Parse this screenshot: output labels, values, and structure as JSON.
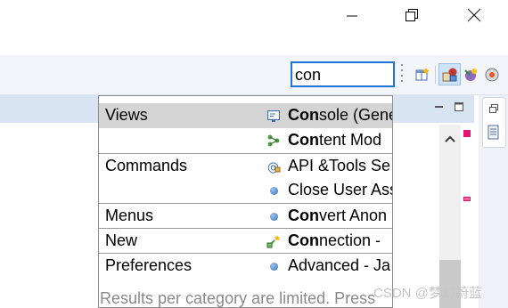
{
  "search": {
    "value": "con"
  },
  "popup": {
    "rows": [
      {
        "category": "Views",
        "match": "Con",
        "rest": "sole (Gene",
        "icon": "console-icon"
      },
      {
        "category": "",
        "match": "Con",
        "rest": "tent Mod",
        "icon": "content-model-icon"
      },
      {
        "category": "Commands",
        "match": "",
        "rest": "API &Tools Se",
        "icon": "api-tools-icon"
      },
      {
        "category": "",
        "match": "",
        "rest": "Close User Ass",
        "icon": "bullet-icon"
      },
      {
        "category": "Menus",
        "match": "Con",
        "rest": "vert Anon",
        "icon": "bullet-icon"
      },
      {
        "category": "New",
        "match": "Con",
        "rest": "nection -",
        "icon": "new-connection-icon"
      },
      {
        "category": "Preferences",
        "match": "",
        "rest": "Advanced - Ja",
        "icon": "bullet-icon"
      }
    ],
    "footer": "Results per category are limited. Press"
  },
  "watermark": "CSDN @梦幻蔚蓝"
}
